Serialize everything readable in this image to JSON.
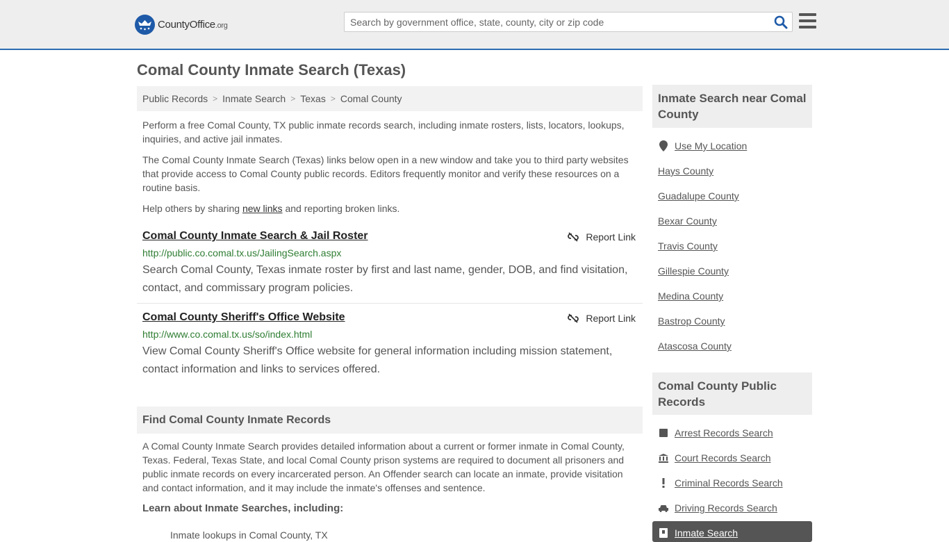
{
  "header": {
    "logo": {
      "name": "County",
      "office": "Office",
      "tld": ".org"
    },
    "search_placeholder": "Search by government office, state, county, city or zip code"
  },
  "page_title": "Comal County Inmate Search (Texas)",
  "breadcrumb": [
    "Public Records",
    "Inmate Search",
    "Texas",
    "Comal County"
  ],
  "intro": {
    "p1": "Perform a free Comal County, TX public inmate records search, including inmate rosters, lists, locators, lookups, inquiries, and active jail inmates.",
    "p2": "The Comal County Inmate Search (Texas) links below open in a new window and take you to third party websites that provide access to Comal County public records. Editors frequently monitor and verify these resources on a routine basis.",
    "p3_before": "Help others by sharing ",
    "p3_link": "new links",
    "p3_after": " and reporting broken links."
  },
  "results": [
    {
      "title": "Comal County Inmate Search & Jail Roster",
      "url": "http://public.co.comal.tx.us/JailingSearch.aspx",
      "desc": "Search Comal County, Texas inmate roster by first and last name, gender, DOB, and find visitation, contact, and commissary program policies.",
      "report": "Report Link"
    },
    {
      "title": "Comal County Sheriff's Office Website",
      "url": "http://www.co.comal.tx.us/so/index.html",
      "desc": "View Comal County Sheriff's Office website for general information including mission statement, contact information and links to services offered.",
      "report": "Report Link"
    }
  ],
  "find_section": {
    "heading": "Find Comal County Inmate Records",
    "body": "A Comal County Inmate Search provides detailed information about a current or former inmate in Comal County, Texas. Federal, Texas State, and local Comal County prison systems are required to document all prisoners and public inmate records on every incarcerated person. An Offender search can locate an inmate, provide visitation and contact information, and it may include the inmate's offenses and sentence.",
    "learn_heading": "Learn about Inmate Searches, including:",
    "bullet_partial": "Inmate lookups in Comal County, TX"
  },
  "sidebar": {
    "near_heading": "Inmate Search near Comal County",
    "near_links": [
      "Use My Location",
      "Hays County",
      "Guadalupe County",
      "Bexar County",
      "Travis County",
      "Gillespie County",
      "Medina County",
      "Bastrop County",
      "Atascosa County"
    ],
    "records_heading": "Comal County Public Records",
    "records_links": [
      {
        "label": "Arrest Records Search",
        "icon": "square-icon"
      },
      {
        "label": "Court Records Search",
        "icon": "courthouse-icon"
      },
      {
        "label": "Criminal Records Search",
        "icon": "exclamation-icon"
      },
      {
        "label": "Driving Records Search",
        "icon": "car-icon"
      },
      {
        "label": "Inmate Search",
        "icon": "inmate-icon"
      }
    ]
  }
}
